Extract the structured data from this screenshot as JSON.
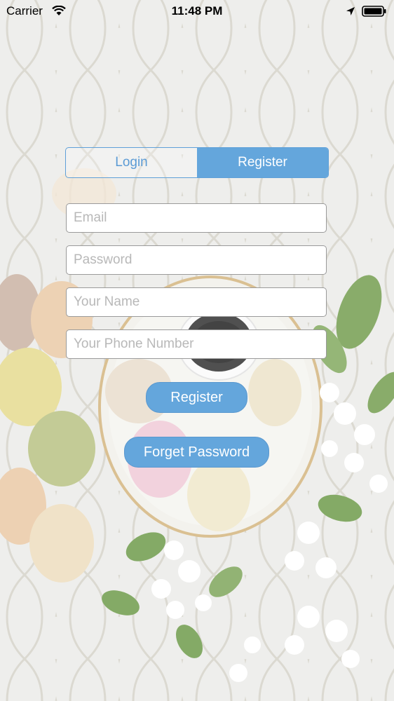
{
  "status_bar": {
    "carrier": "Carrier",
    "time": "11:48 PM",
    "icons": [
      "wifi-icon",
      "location-arrow-icon",
      "battery-icon"
    ]
  },
  "auth_tabs": {
    "tabs": [
      {
        "label": "Login",
        "selected": false
      },
      {
        "label": "Register",
        "selected": true
      }
    ]
  },
  "form": {
    "email_placeholder": "Email",
    "password_placeholder": "Password",
    "name_placeholder": "Your Name",
    "phone_placeholder": "Your Phone Number"
  },
  "actions": {
    "register_label": "Register",
    "forget_password_label": "Forget Password"
  },
  "colors": {
    "accent": "#64a6dc",
    "input_border": "#9a9a9a",
    "background": "#e6e6e3"
  }
}
